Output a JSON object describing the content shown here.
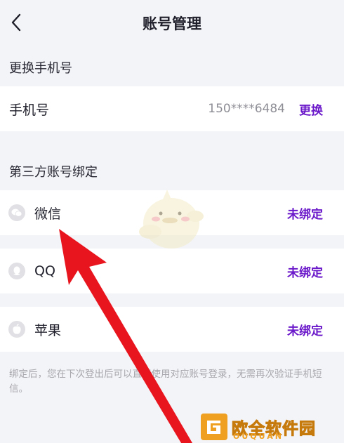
{
  "header": {
    "title": "账号管理",
    "back_icon": "chevron-left-icon"
  },
  "phone_section": {
    "heading": "更换手机号",
    "row": {
      "label": "手机号",
      "value": "150****6484",
      "action": "更换"
    }
  },
  "third_party_section": {
    "heading": "第三方账号绑定",
    "items": [
      {
        "label": "微信",
        "status": "未绑定",
        "icon": "wechat-icon"
      },
      {
        "label": "QQ",
        "status": "未绑定",
        "icon": "qq-icon"
      },
      {
        "label": "苹果",
        "status": "未绑定",
        "icon": "apple-icon"
      }
    ]
  },
  "note": "绑定后，您在下次登出后可以直接使用对应账号登录，无需再次验证手机短信。",
  "logo": {
    "title": "欧全软件园",
    "subtitle": "OUQUAN"
  },
  "colors": {
    "accent": "#6a18c9",
    "background": "#f3f4f7",
    "row": "#ffffff",
    "arrow": "#e8141e",
    "logo": "#f0a020"
  }
}
